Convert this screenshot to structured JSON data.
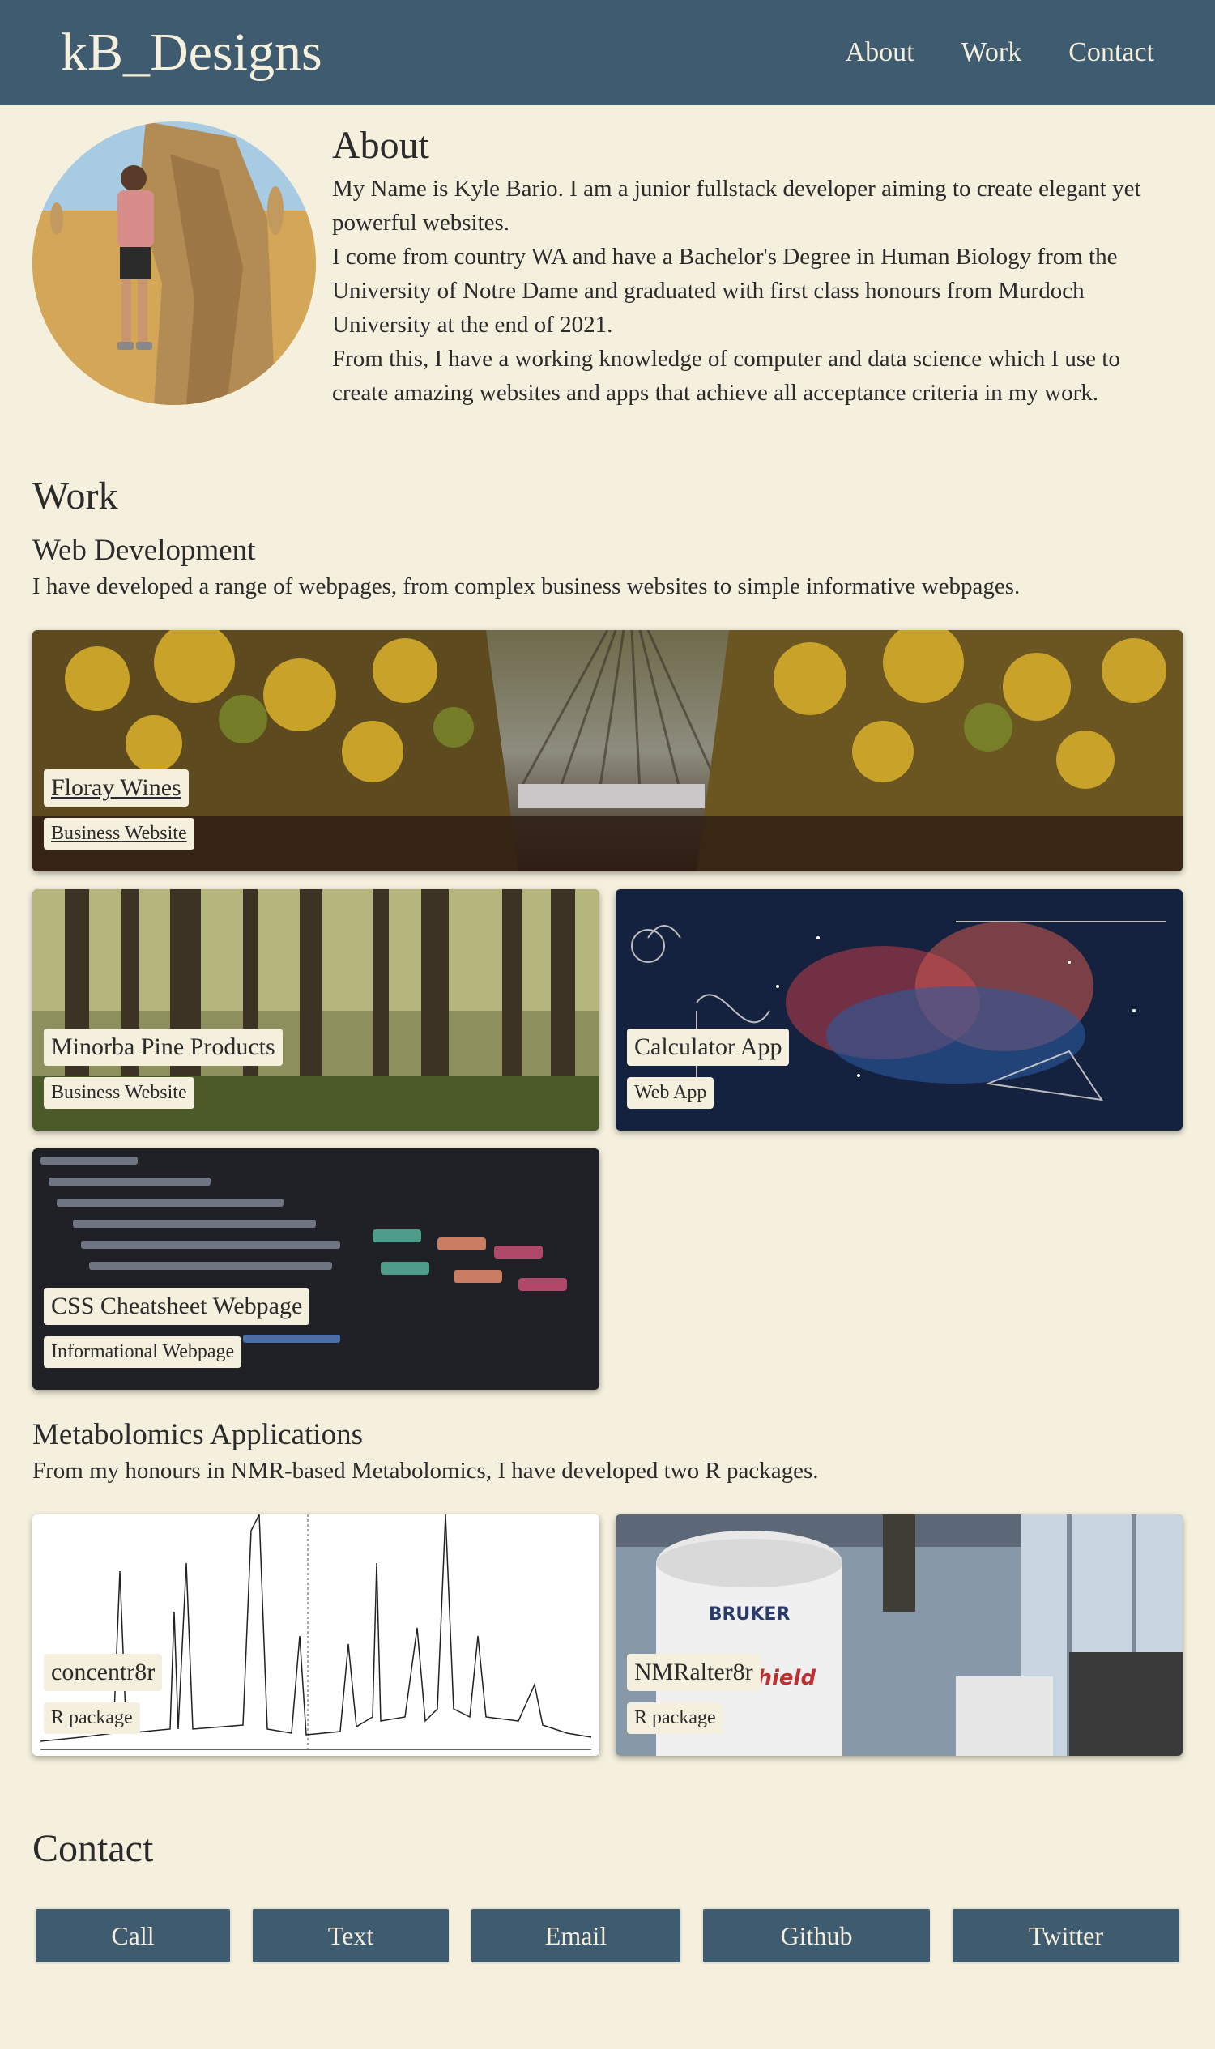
{
  "header": {
    "brand": "kB_Designs",
    "nav": [
      "About",
      "Work",
      "Contact"
    ]
  },
  "about": {
    "title": "About",
    "paragraphs": [
      "My Name is Kyle Bario. I am a junior fullstack developer aiming to create elegant yet powerful websites.",
      "I come from country WA and have a Bachelor's Degree in Human Biology from the University of Notre Dame and graduated with first class honours from Murdoch University at the end of 2021.",
      "From this, I have a working knowledge of computer and data science which I use to create amazing websites and apps that achieve all acceptance criteria in my work."
    ]
  },
  "work": {
    "title": "Work",
    "web": {
      "title": "Web Development",
      "desc": "I have developed a range of webpages, from complex business websites to simple informative webpages.",
      "projects": [
        {
          "title": "Floray Wines",
          "type": "Business Website"
        },
        {
          "title": "Minorba Pine Products",
          "type": "Business Website"
        },
        {
          "title": "Calculator App",
          "type": "Web App"
        },
        {
          "title": "CSS Cheatsheet Webpage",
          "type": "Informational Webpage"
        }
      ]
    },
    "metabolomics": {
      "title": "Metabolomics Applications",
      "desc": "From my honours in NMR-based Metabolomics, I have developed two R packages.",
      "projects": [
        {
          "title": "concentr8r",
          "type": "R package"
        },
        {
          "title": "NMRalter8r",
          "type": "R package"
        }
      ]
    }
  },
  "contact": {
    "title": "Contact",
    "buttons": [
      "Call",
      "Text",
      "Email",
      "Github",
      "Twitter"
    ]
  },
  "images": {
    "magnet_brand": "BRUKER",
    "magnet_label": "UltraShield"
  },
  "colors": {
    "header": "#3f5b70",
    "background": "#f5f0de",
    "button": "#3f5b70"
  }
}
